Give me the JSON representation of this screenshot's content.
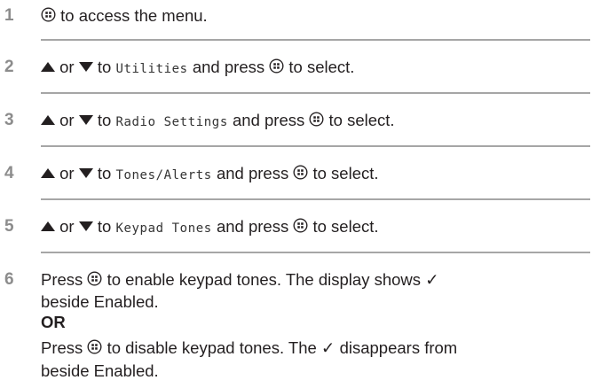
{
  "steps": [
    {
      "number": "1",
      "text_after_icon": "to access the menu."
    },
    {
      "number": "2",
      "or": "or",
      "to": "to",
      "item": "Utilities",
      "and_press": "and press",
      "to_select": "to select."
    },
    {
      "number": "3",
      "or": "or",
      "to": "to",
      "item": "Radio Settings",
      "and_press": "and press",
      "to_select": "to select."
    },
    {
      "number": "4",
      "or": "or",
      "to": "to",
      "item": "Tones/Alerts",
      "and_press": "and press",
      "to_select": "to select."
    },
    {
      "number": "5",
      "or": "or",
      "to": "to",
      "item": "Keypad Tones",
      "and_press": "and press",
      "to_select": "to select."
    },
    {
      "number": "6",
      "line1_press": "Press",
      "line1_rest": "to enable keypad tones. The display shows ✓",
      "line2": "beside Enabled.",
      "or_label": "OR",
      "line4_press": "Press",
      "line4_rest": "to disable keypad tones. The ✓ disappears from",
      "line5": "beside Enabled."
    }
  ],
  "icons": {
    "menu": "menu-ok-button-icon",
    "up": "up-arrow-icon",
    "down": "down-arrow-icon"
  },
  "colors": {
    "step_number": "#8c8c8c",
    "divider": "#a6a6a6",
    "text": "#231f20"
  }
}
